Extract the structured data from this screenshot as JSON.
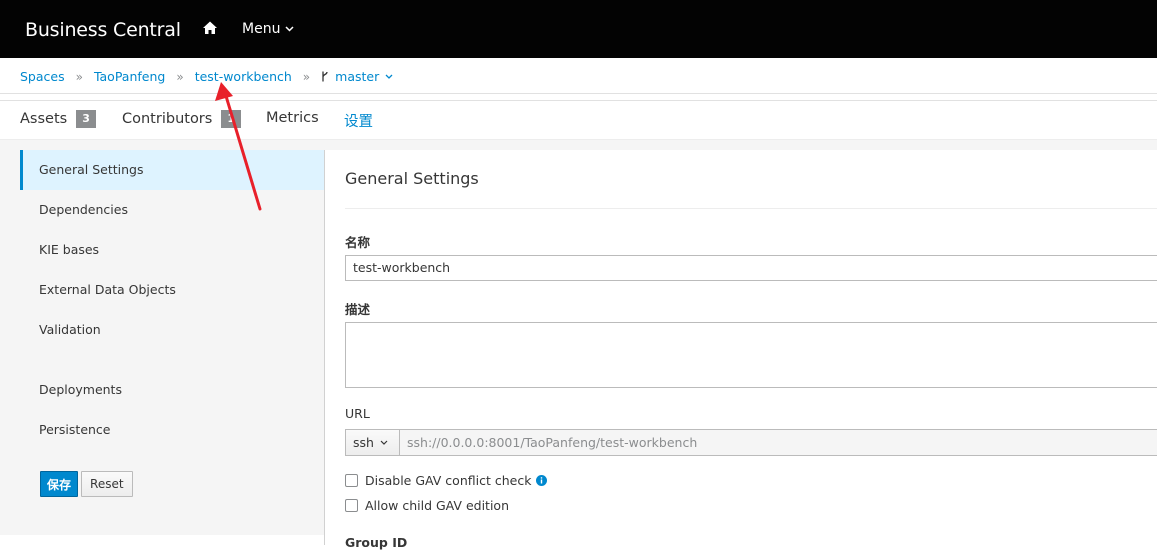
{
  "header": {
    "brand": "Business Central",
    "menu_label": "Menu",
    "icons": {
      "home": "home-icon",
      "menu_caret": "chevron-down-icon"
    }
  },
  "breadcrumb": {
    "items": [
      "Spaces",
      "TaoPanfeng",
      "test-workbench"
    ],
    "branch": "master",
    "separator": "»"
  },
  "tabs": [
    {
      "label": "Assets",
      "badge": "3"
    },
    {
      "label": "Contributors",
      "badge": "1"
    },
    {
      "label": "Metrics"
    },
    {
      "label": "设置",
      "active": true
    }
  ],
  "sidebar": {
    "items": [
      {
        "label": "General Settings",
        "active": true
      },
      {
        "label": "Dependencies"
      },
      {
        "label": "KIE bases"
      },
      {
        "label": "External Data Objects"
      },
      {
        "label": "Validation"
      },
      {
        "label": "Deployments"
      },
      {
        "label": "Persistence"
      }
    ],
    "save_label": "保存",
    "reset_label": "Reset"
  },
  "main": {
    "title": "General Settings",
    "name_label": "名称",
    "name_value": "test-workbench",
    "description_label": "描述",
    "url_label": "URL",
    "url_protocol": "ssh",
    "url_value": "ssh://0.0.0.0:8001/TaoPanfeng/test-workbench",
    "disable_gav_label": "Disable GAV conflict check",
    "allow_child_gav_label": "Allow child GAV edition",
    "group_id_label": "Group ID"
  },
  "colors": {
    "accent": "#0088ce",
    "topbar": "#030303",
    "annotation_arrow": "#e8202a"
  }
}
